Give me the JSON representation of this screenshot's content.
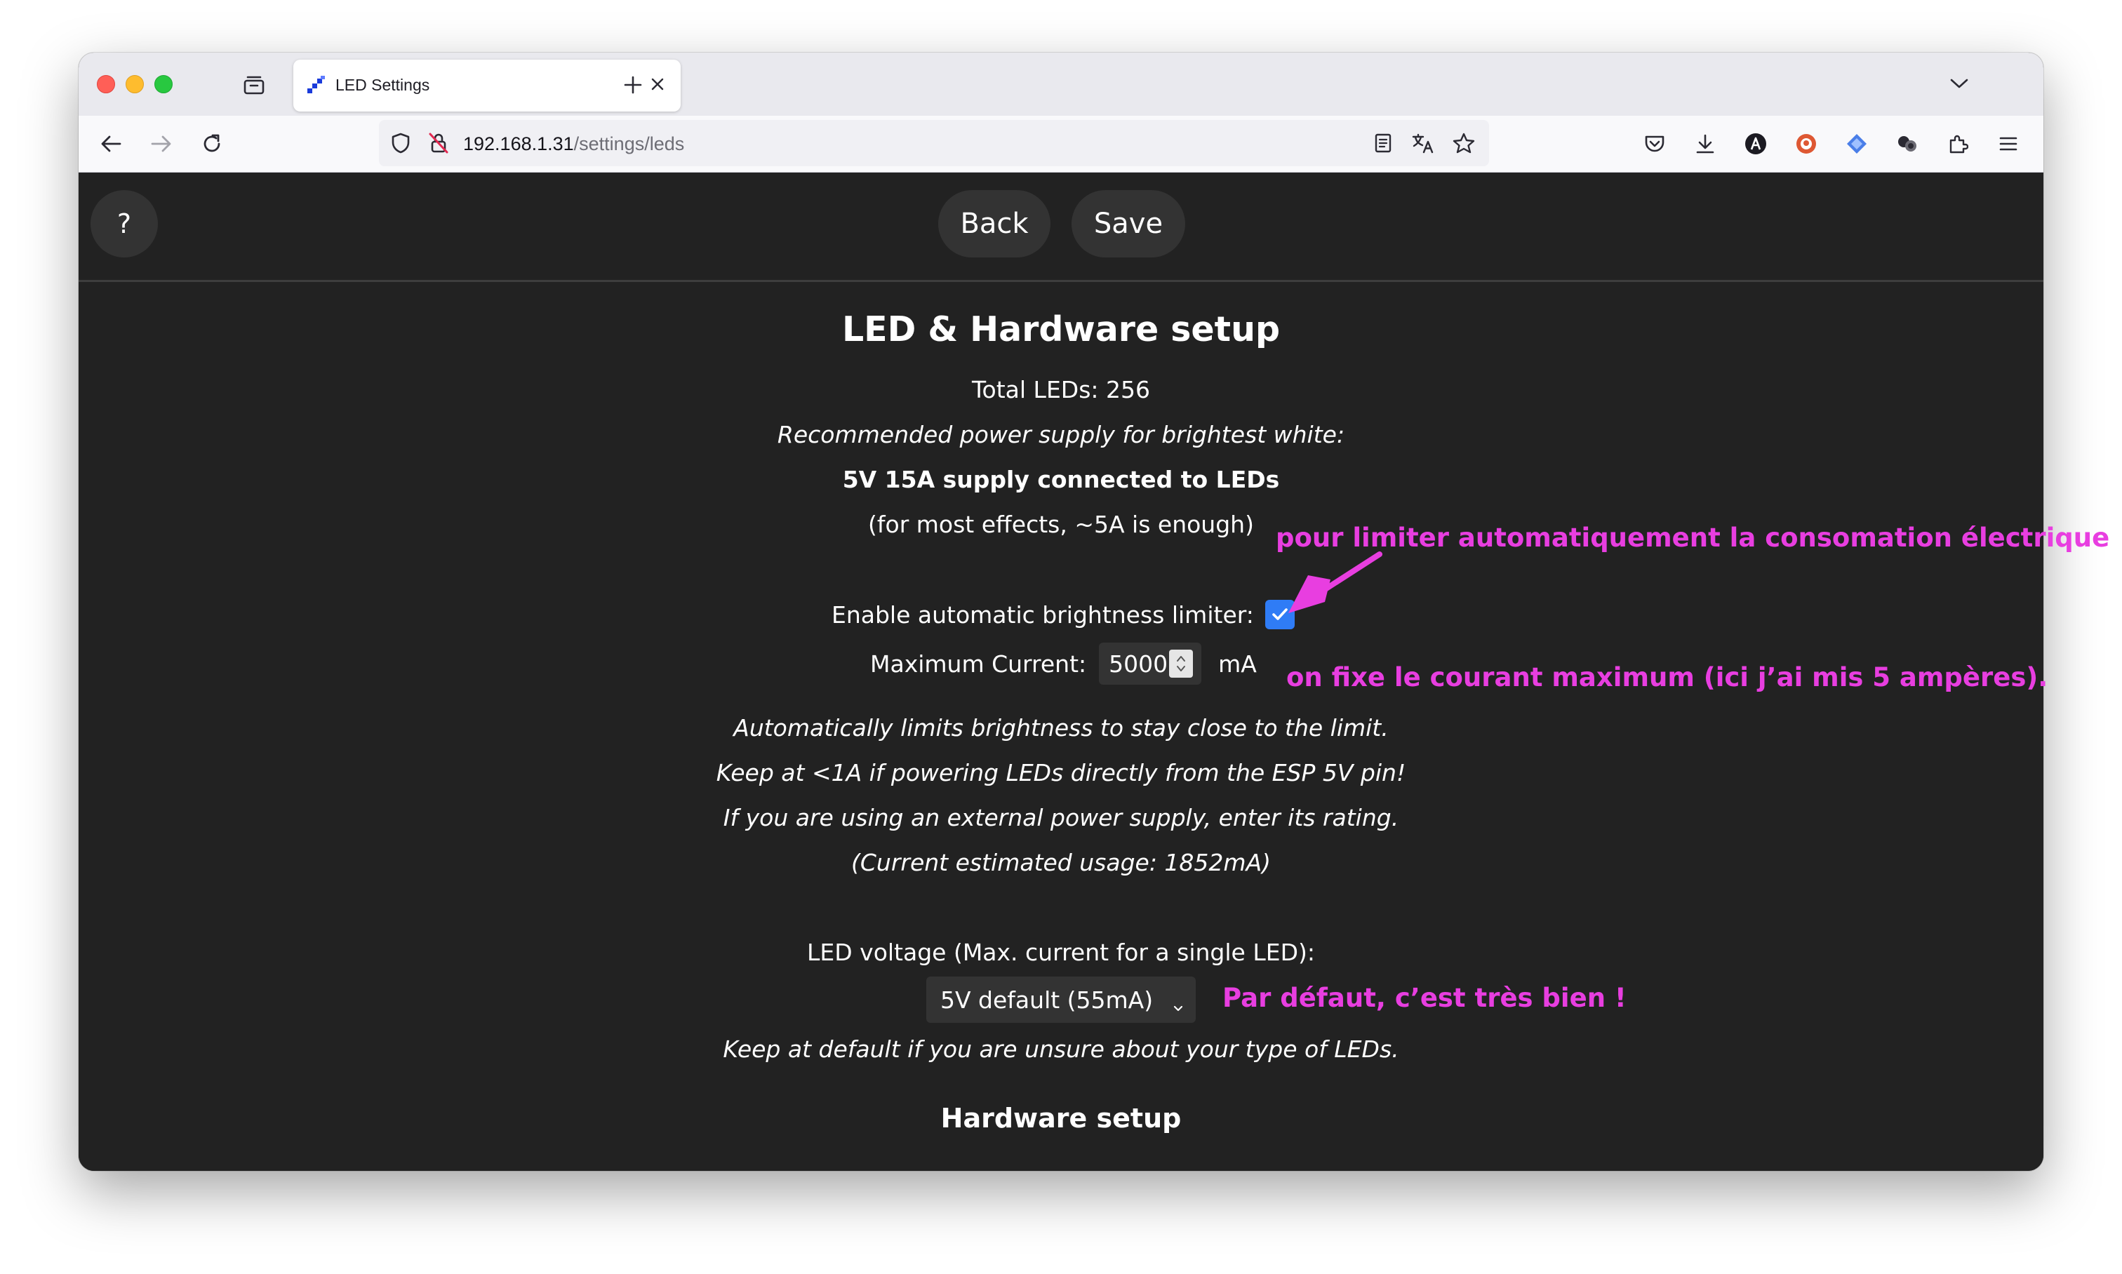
{
  "browser": {
    "tab_title": "LED Settings",
    "url_host": "192.168.1.31",
    "url_path": "/settings/leds"
  },
  "page": {
    "help_label": "?",
    "back_label": "Back",
    "save_label": "Save",
    "title": "LED & Hardware setup",
    "total_leds": "Total LEDs: 256",
    "recommended": "Recommended power supply for brightest white:",
    "supply": "5V 15A supply connected to LEDs",
    "most_effects": "(for most effects, ~5A is enough)",
    "abl_label": "Enable automatic brightness limiter:",
    "abl_checked": true,
    "max_current_label": "Maximum Current:",
    "max_current_value": "5000",
    "max_current_unit": "mA",
    "note1": "Automatically limits brightness to stay close to the limit.",
    "note2": "Keep at <1A if powering LEDs directly from the ESP 5V pin!",
    "note3": "If you are using an external power supply, enter its rating.",
    "note4": "(Current estimated usage: 1852mA)",
    "voltage_label": "LED voltage (Max. current for a single LED):",
    "voltage_selected": "5V default (55mA)",
    "voltage_note": "Keep at default if you are unsure about your type of LEDs.",
    "hardware_title": "Hardware setup"
  },
  "annotations": {
    "a1": "pour limiter automatiquement la consomation électrique",
    "a2": "on fixe le courant maximum (ici j’ai mis 5 ampères).",
    "a3": "Par défaut, c’est très bien !",
    "color": "#e83ee0"
  }
}
